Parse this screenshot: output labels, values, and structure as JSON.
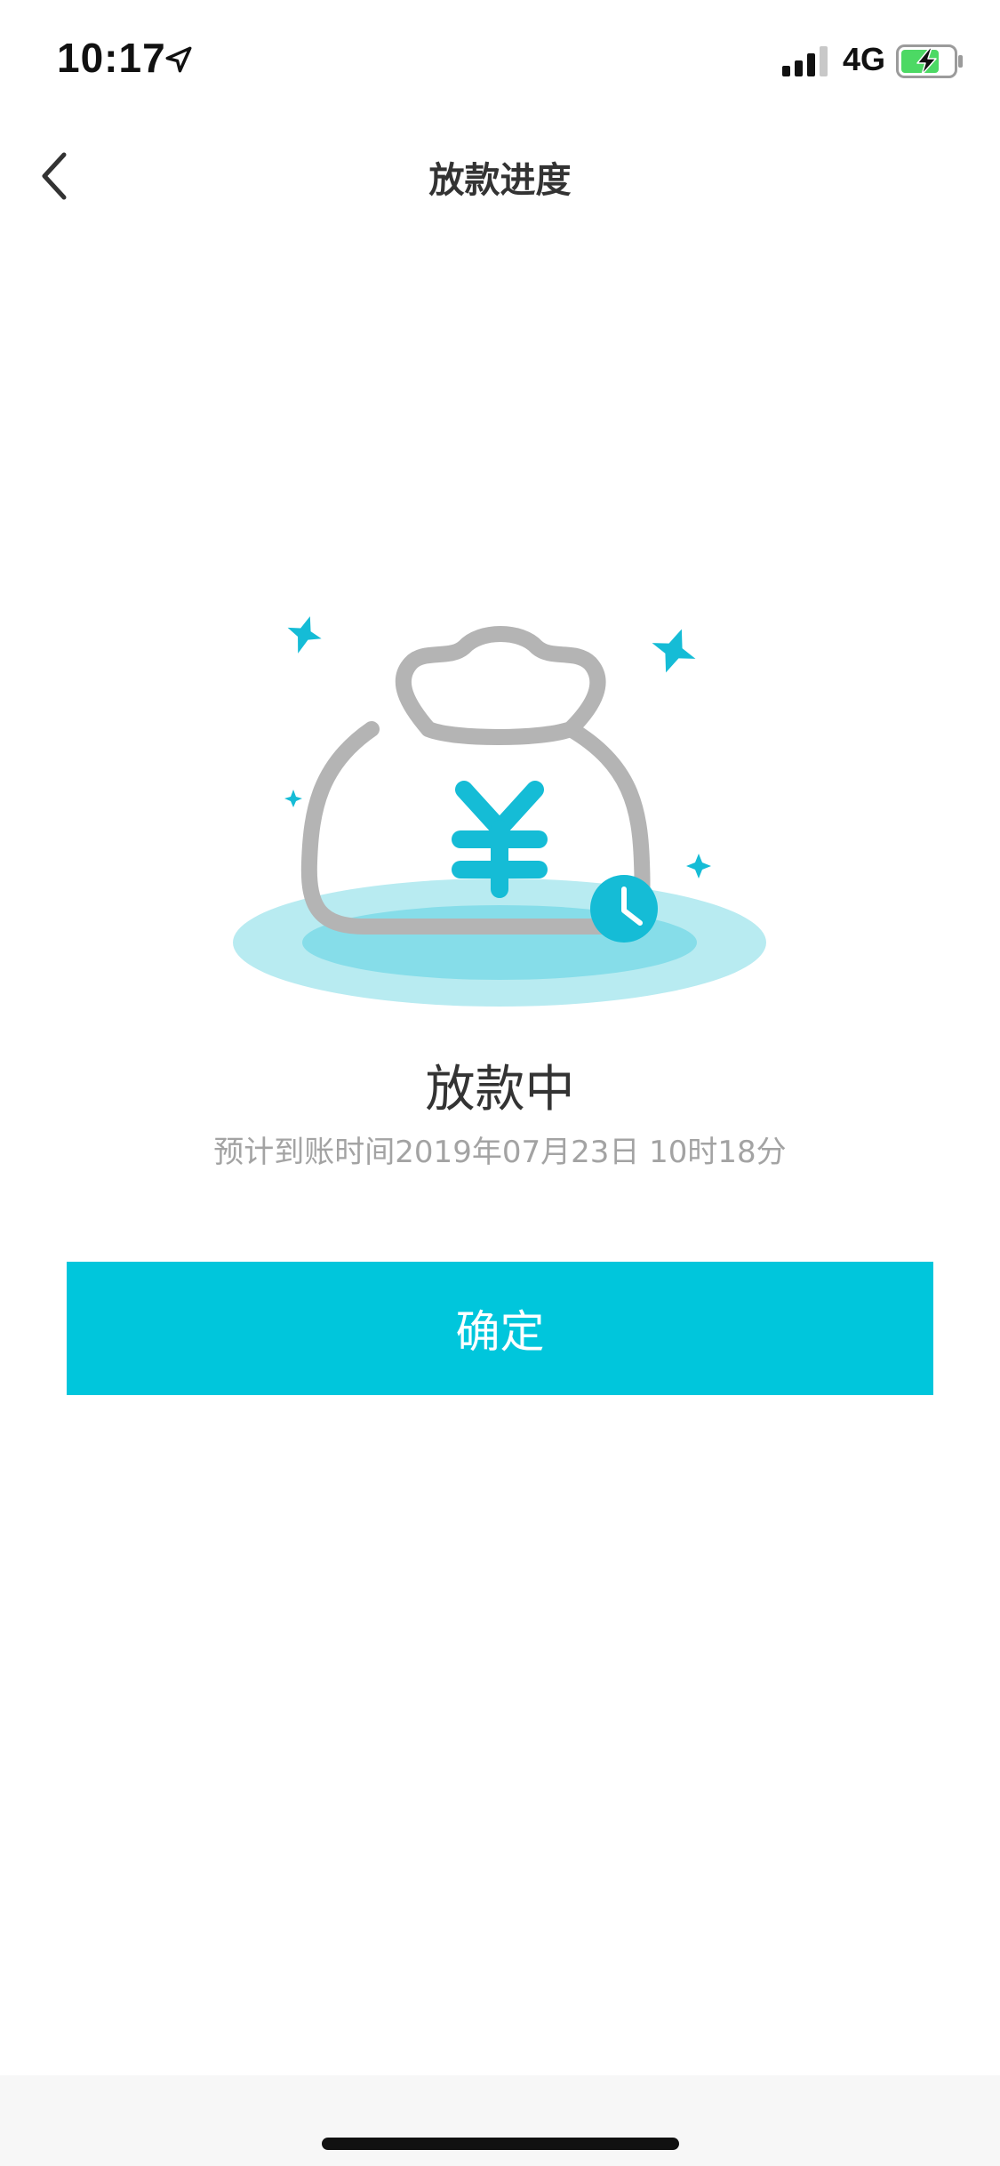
{
  "status_bar": {
    "time": "10:17",
    "network": "4G",
    "icons": {
      "location": "location-arrow-icon",
      "signal": "signal-bars-icon",
      "battery": "battery-charging-icon"
    },
    "battery_color": "#4cd964"
  },
  "nav": {
    "title": "放款进度",
    "back_icon": "chevron-left-icon"
  },
  "illustration": {
    "icon": "money-bag-yuan-icon",
    "badge_icon": "clock-icon",
    "accent_color": "#15bcd6"
  },
  "status": {
    "title": "放款中",
    "description": "预计到账时间2019年07月23日 10时18分"
  },
  "actions": {
    "confirm_label": "确定",
    "confirm_color": "#00c6dc"
  }
}
